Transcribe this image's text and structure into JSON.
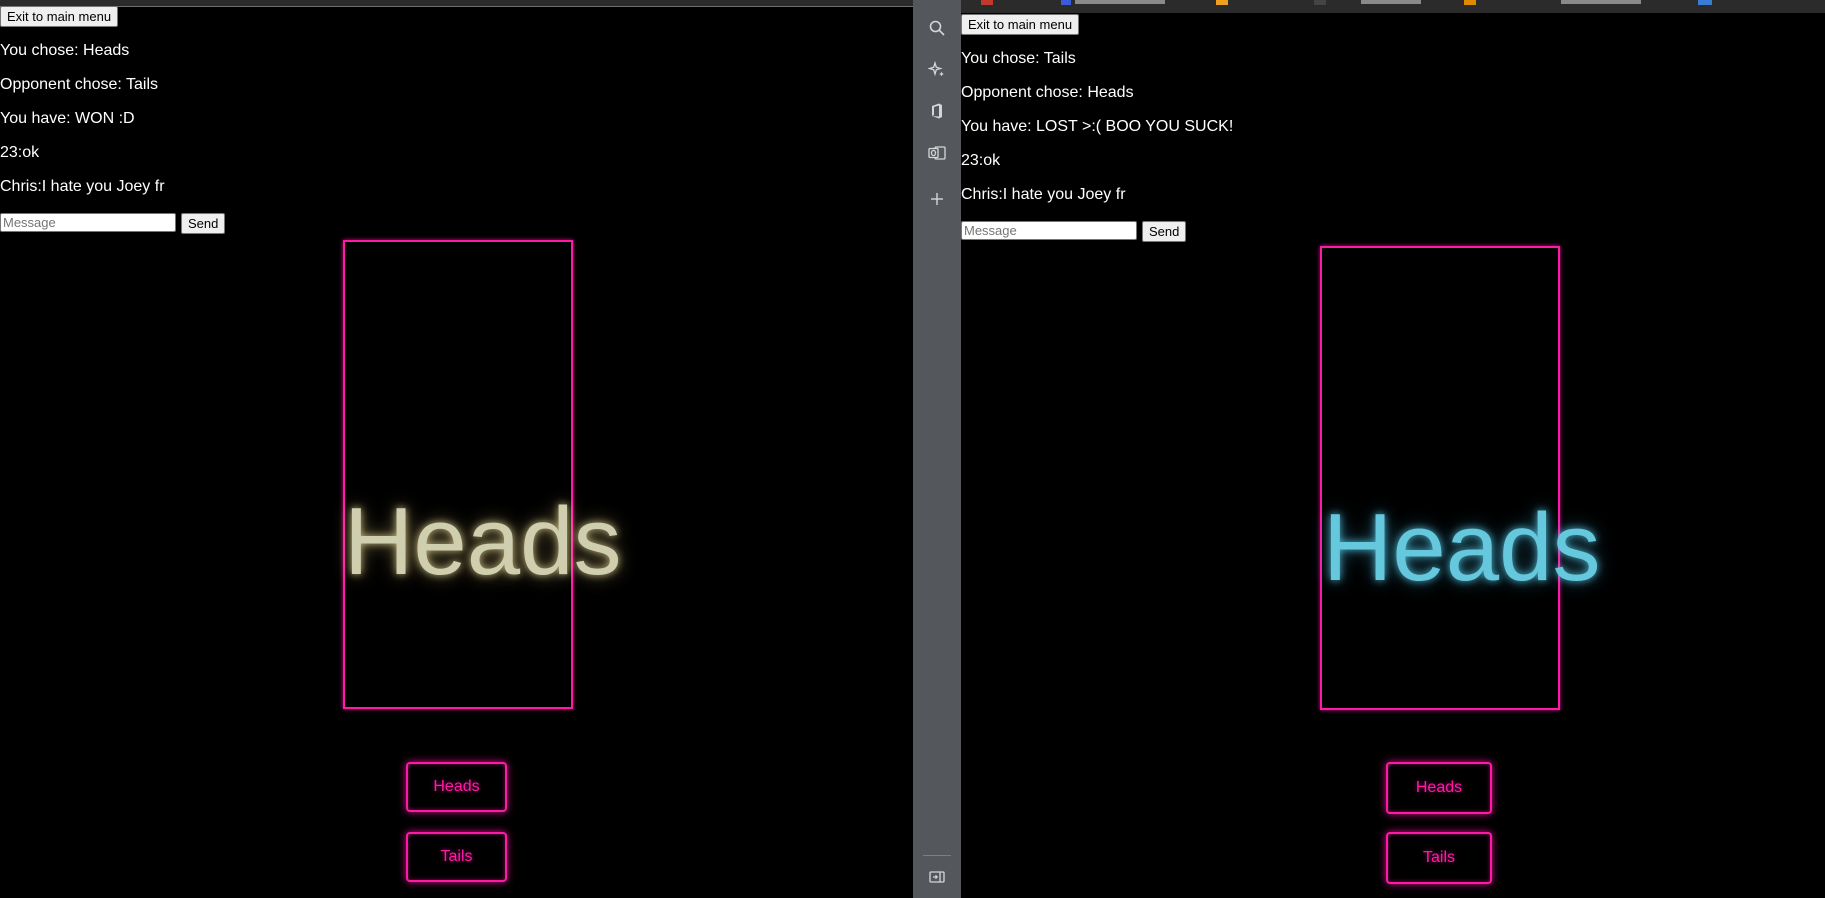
{
  "left": {
    "exit_label": "Exit to main menu",
    "you_chose": "You chose: Heads",
    "opponent_chose": "Opponent chose: Tails",
    "result": "You have: WON :D",
    "chat": [
      "23:ok",
      "Chris:I hate you Joey fr"
    ],
    "message_placeholder": "Message",
    "send_label": "Send",
    "coin_face": "Heads",
    "coin_color": "#cfcfb0",
    "heads_button": "Heads",
    "tails_button": "Tails"
  },
  "right": {
    "exit_label": "Exit to main menu",
    "you_chose": "You chose: Tails",
    "opponent_chose": "Opponent chose: Heads",
    "result": "You have: LOST >:( BOO YOU SUCK!",
    "chat": [
      "23:ok",
      "Chris:I hate you Joey fr"
    ],
    "message_placeholder": "Message",
    "send_label": "Send",
    "coin_face": "Heads",
    "coin_color": "#66c8dc",
    "heads_button": "Heads",
    "tails_button": "Tails"
  },
  "theme": {
    "accent": "#ff1aa6",
    "background": "#000000",
    "sidebar": "#54575c"
  },
  "sidebar": {
    "icons": [
      "search-icon",
      "sparkle-icon",
      "office-icon",
      "outlook-icon",
      "add-icon",
      "collapse-sidebar-icon"
    ]
  }
}
